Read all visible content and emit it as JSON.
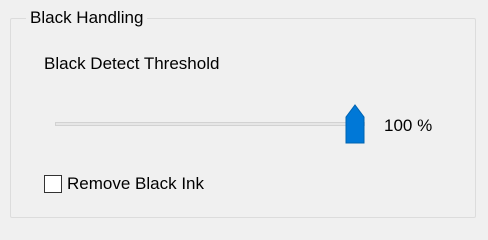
{
  "group": {
    "title": "Black Handling"
  },
  "threshold": {
    "label": "Black Detect Threshold",
    "value_text": "100 %",
    "value_percent": 100,
    "thumb_color": "#0078d7"
  },
  "remove_black_ink": {
    "label": "Remove Black Ink",
    "checked": false
  }
}
